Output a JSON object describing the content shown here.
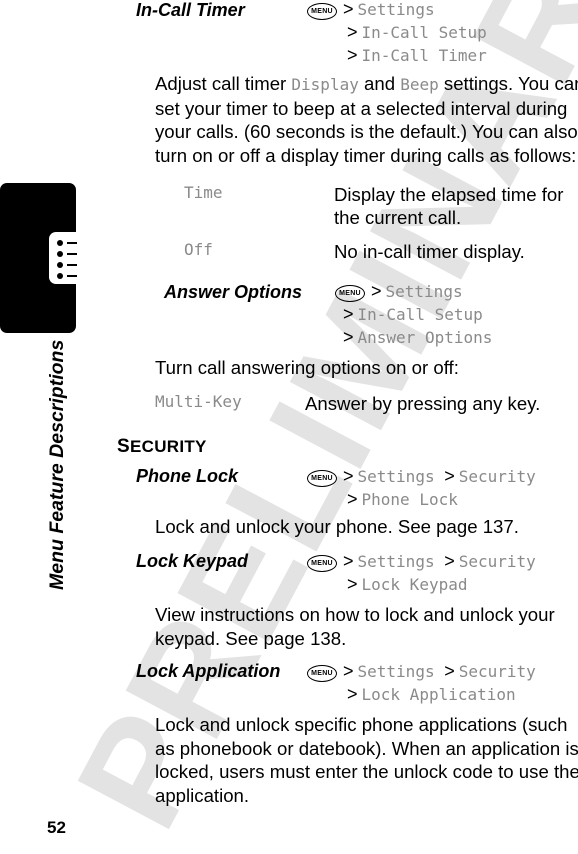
{
  "watermark": "PRELIMINARY",
  "side_title": "Menu Feature Descriptions",
  "page_number": "52",
  "menu_key_label": "MENU",
  "separator": ">",
  "in_call_timer": {
    "title": "In-Call Timer",
    "path": [
      "Settings",
      "In-Call Setup",
      "In-Call Timer"
    ],
    "desc": {
      "l1a": "Adjust call timer ",
      "l1b": "Display",
      "l1c": " and ",
      "l1d": "Beep",
      "l1e": " settings. You can",
      "l2": "set your timer to beep at a selected interval during",
      "l3": "your calls. (60 seconds is the default.) You can also",
      "l4": "turn on or off a display timer during calls as follows:"
    },
    "options": [
      {
        "name": "Time",
        "desc": [
          "Display the elapsed time for",
          "the current call."
        ]
      },
      {
        "name": "Off",
        "desc": [
          "No in-call timer display."
        ]
      }
    ]
  },
  "answer_options": {
    "title": "Answer Options",
    "path": [
      "Settings",
      "In-Call Setup",
      "Answer Options"
    ],
    "desc": "Turn call answering options on or off:",
    "options": [
      {
        "name": "Multi-Key",
        "desc": "Answer by pressing any key."
      }
    ]
  },
  "security": {
    "heading_first": "S",
    "heading_rest": "ECURITY",
    "items": [
      {
        "title": "Phone Lock",
        "path1": [
          "Settings",
          "Security"
        ],
        "path2": "Phone Lock",
        "desc": [
          "Lock and unlock your phone. See page 137."
        ]
      },
      {
        "title": "Lock Keypad",
        "path1": [
          "Settings",
          "Security"
        ],
        "path2": "Lock Keypad",
        "desc": [
          "View instructions on how to lock and unlock your",
          "keypad. See page 138."
        ]
      },
      {
        "title": "Lock Application",
        "path1": [
          "Settings",
          "Security"
        ],
        "path2": "Lock Application",
        "desc": [
          "Lock and unlock specific phone applications (such",
          "as phonebook or datebook). When an application is",
          "locked, users must enter the unlock code to use the",
          "application."
        ]
      }
    ]
  }
}
